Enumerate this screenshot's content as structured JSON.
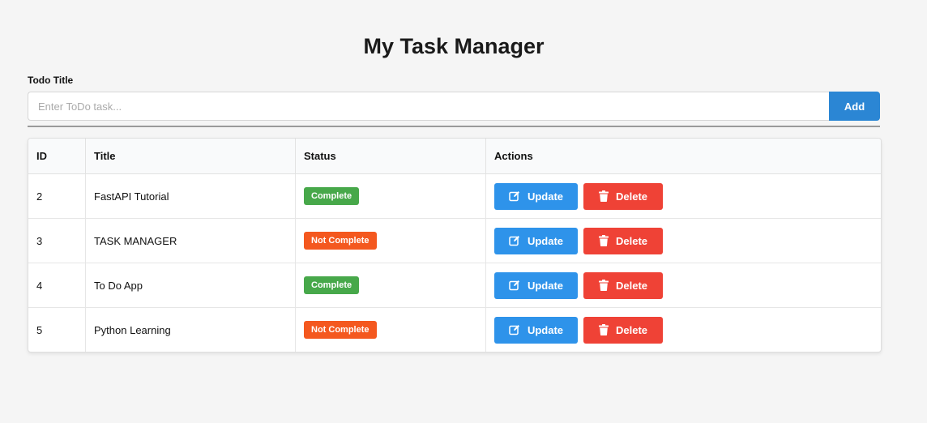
{
  "page": {
    "title": "My Task Manager"
  },
  "form": {
    "label": "Todo Title",
    "placeholder": "Enter ToDo task...",
    "value": "",
    "add_label": "Add"
  },
  "table": {
    "headers": {
      "id": "ID",
      "title": "Title",
      "status": "Status",
      "actions": "Actions"
    },
    "rows": [
      {
        "id": "2",
        "title": "FastAPI Tutorial",
        "status": "Complete",
        "status_color": "#47a84a"
      },
      {
        "id": "3",
        "title": "TASK MANAGER",
        "status": "Not Complete",
        "status_color": "#f4581f"
      },
      {
        "id": "4",
        "title": "To Do App",
        "status": "Complete",
        "status_color": "#47a84a"
      },
      {
        "id": "5",
        "title": "Python Learning",
        "status": "Not Complete",
        "status_color": "#f4581f"
      }
    ],
    "update_label": "Update",
    "delete_label": "Delete",
    "update_icon": "edit-icon",
    "delete_icon": "trash-icon"
  },
  "colors": {
    "background": "#f5f5f5",
    "add_button": "#2b86d4",
    "update_button": "#2e93ea",
    "delete_button": "#ef4236",
    "complete_badge": "#47a84a",
    "not_complete_badge": "#f4581f"
  }
}
